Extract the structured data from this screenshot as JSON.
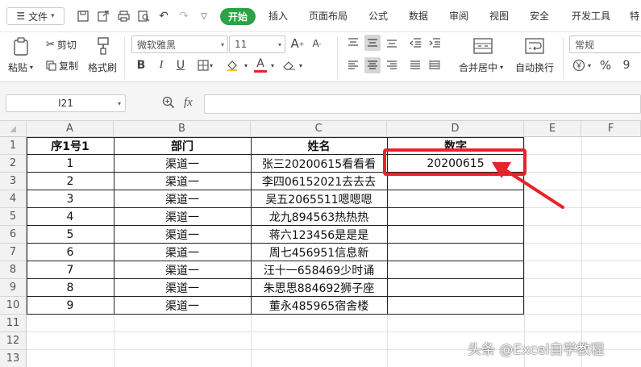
{
  "menu": {
    "file_label": "文件",
    "tabs": [
      "插入",
      "页面布局",
      "公式",
      "数据",
      "审阅",
      "视图",
      "安全",
      "开发工具",
      "特"
    ],
    "active_tab": "开始"
  },
  "ribbon": {
    "paste_label": "粘贴",
    "cut_label": "剪切",
    "copy_label": "复制",
    "format_painter_label": "格式刷",
    "font_name": "微软雅黑",
    "font_size": "11",
    "merge_label": "合并居中",
    "wrap_label": "自动换行",
    "number_format": "常规",
    "bold": "B",
    "italic": "I",
    "underline": "U",
    "font_color_letter": "A",
    "grow_font": "A",
    "shrink_font": "A",
    "percent": "%",
    "comma": "9"
  },
  "formula_bar": {
    "name_box": "I21",
    "fx": "fx",
    "value": ""
  },
  "sheet": {
    "columns": [
      "A",
      "B",
      "C",
      "D",
      "E",
      "F"
    ],
    "rows": [
      "1",
      "2",
      "3",
      "4",
      "5",
      "6",
      "7",
      "8",
      "9",
      "10",
      "11",
      "12",
      "13"
    ],
    "headers": [
      "序1号1",
      "部门",
      "姓名",
      "数字"
    ],
    "data": [
      [
        "1",
        "渠道一",
        "张三20200615看看看",
        "20200615"
      ],
      [
        "2",
        "渠道一",
        "李四06152021去去去",
        ""
      ],
      [
        "3",
        "渠道一",
        "吴五2065511嗯嗯嗯",
        ""
      ],
      [
        "4",
        "渠道一",
        "龙九894563热热热",
        ""
      ],
      [
        "5",
        "渠道一",
        "蒋六123456是是是",
        ""
      ],
      [
        "6",
        "渠道一",
        "周七456951信息新",
        ""
      ],
      [
        "7",
        "渠道一",
        "汪十一658469少时诵",
        ""
      ],
      [
        "8",
        "渠道一",
        "朱思思884692狮子座",
        ""
      ],
      [
        "9",
        "渠道一",
        "董永485965宿舍楼",
        ""
      ]
    ]
  },
  "annotation": {
    "highlight_color": "#e8222a",
    "watermark": "头条 @Excel自学教程"
  },
  "colors": {
    "accent": "#2ba245",
    "selection": "#1a7f37"
  }
}
